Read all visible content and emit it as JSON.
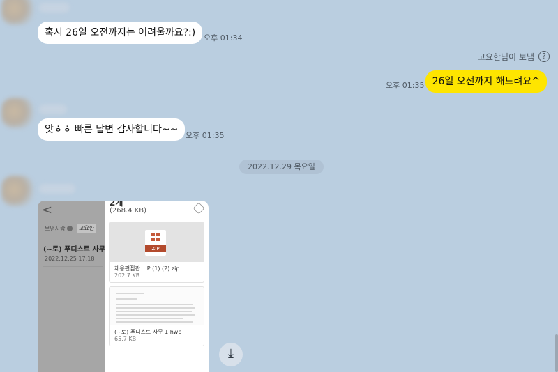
{
  "messages": {
    "m1": {
      "text": "혹시 26일 오전까지는 어려울까요?:)",
      "time": "오후 01:34"
    },
    "m2": {
      "text": "26일 오전까지 해드려요^",
      "time": "오후 01:35"
    },
    "m3": {
      "text": "앗ㅎㅎ 빠른 답변 감사합니다~~",
      "time": "오후 01:35"
    }
  },
  "sender_note": "고요한님이 보냄",
  "help_icon_glyph": "?",
  "date_divider": "2022.12.29 목요일",
  "photo": {
    "back_glyph": "<",
    "sender_label": "보낸사람",
    "sender_tag": "고요한",
    "mail_title": "(~토) 푸디스트 사무",
    "mail_date": "2022.12.25 17:18",
    "attach_count": "2개",
    "attach_size": "(268.4 KB)",
    "files": [
      {
        "name": "채용편집관...IP (1) (2).zip",
        "size": "202.7 KB",
        "badge": "ZIP"
      },
      {
        "name": "(~토) 푸디스트 사무 1.hwp",
        "size": "65.7 KB"
      }
    ],
    "more_glyph": "⋮"
  },
  "scroll_down_glyph": "⤓"
}
